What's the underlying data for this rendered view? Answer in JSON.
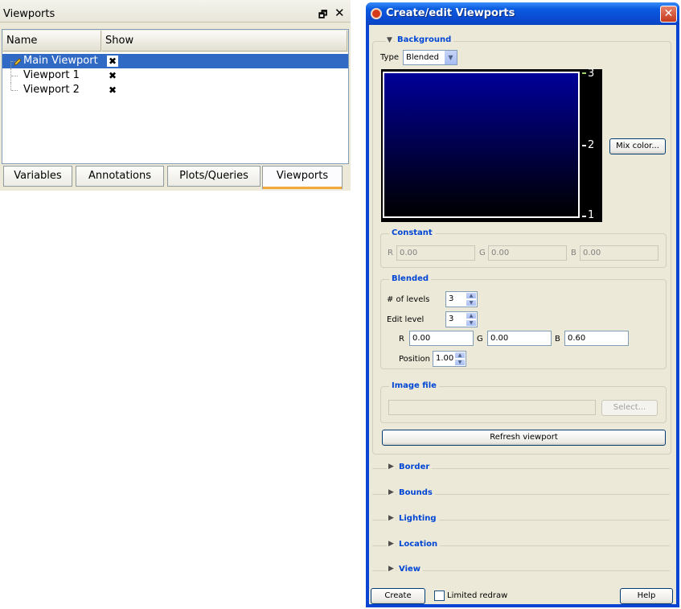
{
  "left_panel": {
    "title": "Viewports",
    "float_glyph": "🗗",
    "close_glyph": "✕",
    "columns": {
      "name": "Name",
      "show": "Show"
    },
    "rows": [
      {
        "name": "Main Viewport",
        "show_icon": "✖",
        "selected": true
      },
      {
        "name": "Viewport 1",
        "show_icon": "✖",
        "selected": false
      },
      {
        "name": "Viewport 2",
        "show_icon": "✖",
        "selected": false
      }
    ],
    "tabs": [
      {
        "label": "Variables",
        "active": false
      },
      {
        "label": "Annotations",
        "active": false
      },
      {
        "label": "Plots/Queries",
        "active": false
      },
      {
        "label": "Viewports",
        "active": true
      }
    ],
    "selection_color": "#316ac5",
    "active_tab_accent": "#f3a93a"
  },
  "dialog": {
    "title": "Create/edit Viewports",
    "close_glyph": "✕",
    "background": {
      "label": "Background",
      "type_label": "Type",
      "type_value": "Blended",
      "mix_color_button": "Mix color...",
      "color_levels": [
        "3",
        "2",
        "1"
      ],
      "gradient_colors": [
        "#000099",
        "#000000"
      ],
      "constant": {
        "label": "Constant",
        "r_label": "R",
        "r_value": "0.00",
        "g_label": "G",
        "g_value": "0.00",
        "b_label": "B",
        "b_value": "0.00"
      },
      "blended": {
        "label": "Blended",
        "levels_label": "# of levels",
        "levels_value": "3",
        "edit_level_label": "Edit level",
        "edit_level_value": "3",
        "r_label": "R",
        "r_value": "0.00",
        "g_label": "G",
        "g_value": "0.00",
        "b_label": "B",
        "b_value": "0.60",
        "position_label": "Position",
        "position_value": "1.00"
      },
      "image_file": {
        "label": "Image file",
        "path_value": "",
        "select_button": "Select..."
      },
      "refresh_button": "Refresh viewport"
    },
    "sections": [
      {
        "label": "Border"
      },
      {
        "label": "Bounds"
      },
      {
        "label": "Lighting"
      },
      {
        "label": "Location"
      },
      {
        "label": "View"
      }
    ],
    "footer": {
      "create_button": "Create",
      "limited_redraw_label": "Limited redraw",
      "limited_redraw_checked": false,
      "help_button": "Help"
    }
  }
}
